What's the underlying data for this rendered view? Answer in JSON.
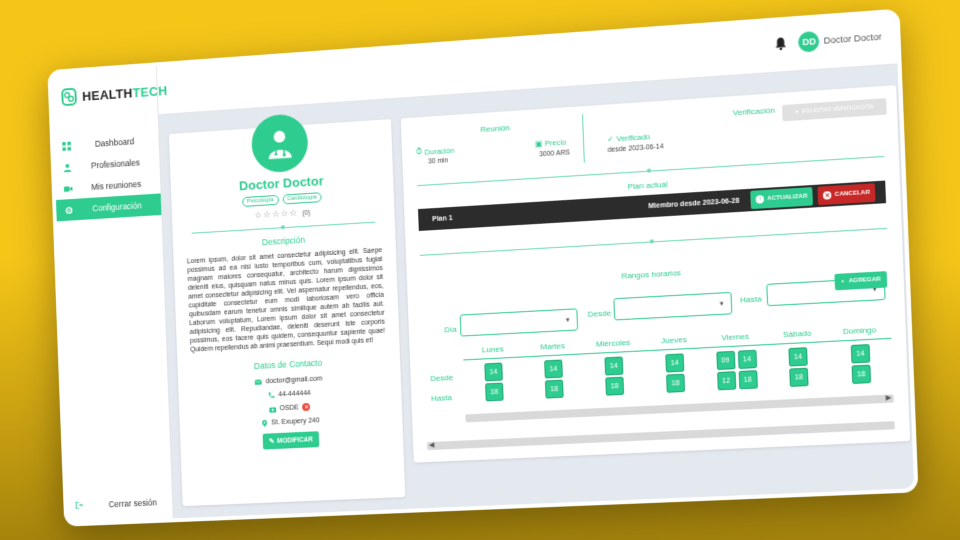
{
  "app": {
    "brand_health": "HEALTH",
    "brand_tech": "TECH",
    "user_initials": "DD",
    "user_name": "Doctor Doctor"
  },
  "sidebar": {
    "items": [
      {
        "label": "Dashboard",
        "icon": "dashboard-icon"
      },
      {
        "label": "Profesionales",
        "icon": "user-icon"
      },
      {
        "label": "Mis reuniones",
        "icon": "video-icon"
      },
      {
        "label": "Configuración",
        "icon": "gear-icon"
      }
    ],
    "active_index": 3,
    "logout_label": "Cerrar sesión"
  },
  "profile": {
    "name": "Doctor Doctor",
    "tags": [
      "Psicología",
      "Cardiología"
    ],
    "rating_count": "(0)",
    "description_title": "Descripción",
    "description": "Lorem ipsum, dolor sit amet consectetur adipisicing elit. Saepe possimus ad ea nisi iusto temporibus cum, voluptatibus fugiat magnam maiores consequatur, architecto harum dignissimos deleniti eius, quisquam natus minus quis. Lorem ipsum dolor sit amet consectetur adipisicing elit. Vel aspernatur repellendus, eos, cupiditate consectetur eum modi laboriosam vero officia quibusdam earum tenetur omnis similique autem ab facilis aut. Laborum voluptatum, Lorem ipsum dolor sit amet consectetur adipisicing elit. Repudiandae, deleniti deserunt iste corporis possimus, eos facere quis quidem, consequuntur sapiente quae! Quidem repellendus ab animi praesentium. Sequi modi quis et!",
    "contact_title": "Datos de Contacto",
    "email": "doctor@gmail.com",
    "phone": "44-444444",
    "insurance": "OSDE",
    "address": "St. Exupery 240",
    "modify_label": "MODIFICAR"
  },
  "meeting": {
    "title": "Reunión",
    "duration_label": "Duración",
    "duration_value": "30 min",
    "price_label": "Precio",
    "price_value": "3000 ARS"
  },
  "verification": {
    "title": "Verificación",
    "status_label": "Verificado",
    "status_since": "desde 2023-06-14",
    "request_label": "SOLICITAR VERIFICACIÓN"
  },
  "plan": {
    "title": "Plan actual",
    "name": "Plan 1",
    "since": "Miembro desde 2023-06-28",
    "update_label": "ACTUALIZAR",
    "cancel_label": "CANCELAR"
  },
  "schedule": {
    "title": "Rangos horarios",
    "day_label": "Día",
    "from_label": "Desde",
    "to_label": "Hasta",
    "add_label": "AGREGAR",
    "row_from": "Desde",
    "row_to": "Hasta",
    "days": [
      "Lunes",
      "Martes",
      "Miércoles",
      "Jueves",
      "Viernes",
      "Sábado",
      "Domingo"
    ],
    "slots": [
      [
        [
          "14",
          "18"
        ]
      ],
      [
        [
          "14",
          "18"
        ]
      ],
      [
        [
          "14",
          "18"
        ]
      ],
      [
        [
          "14",
          "18"
        ]
      ],
      [
        [
          "09",
          "12"
        ],
        [
          "14",
          "18"
        ]
      ],
      [
        [
          "14",
          "18"
        ]
      ],
      [
        [
          "14",
          "18"
        ]
      ]
    ]
  },
  "colors": {
    "accent": "#2ecc8f",
    "danger": "#c62828",
    "dark_bar": "#2c2c2c",
    "background": "#f5c518"
  }
}
